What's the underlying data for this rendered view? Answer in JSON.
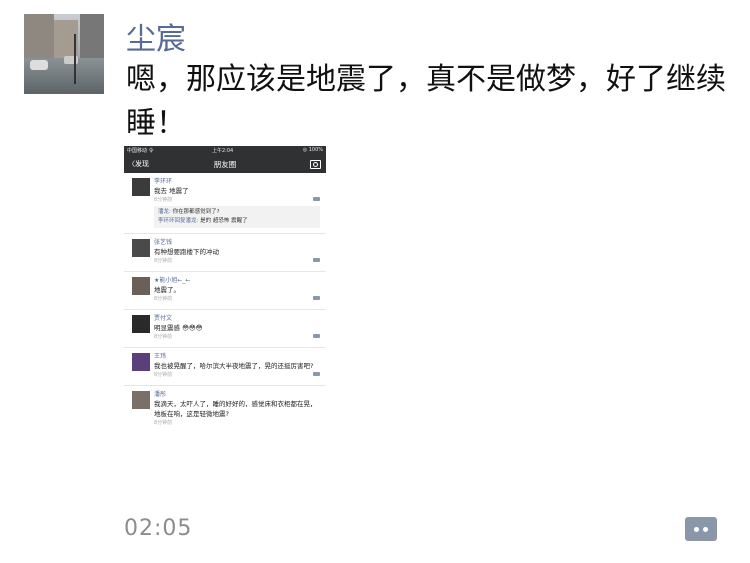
{
  "sender": {
    "name": "尘宸"
  },
  "message": {
    "text": "嗯，那应该是地震了，真不是做梦，好了继续睡！"
  },
  "time": "02:05",
  "phone": {
    "status_bar": {
      "carrier": "中国移动 令",
      "clock": "上午2:04",
      "battery": "◎ 100%"
    },
    "nav": {
      "back_label": "〈发现",
      "title": "朋友圈"
    },
    "posts": [
      {
        "name": "李环环",
        "text": "我去 地震了",
        "meta": "8分钟前",
        "replies": [
          {
            "who": "潘龙:",
            "text": "你在那都感觉到了?"
          },
          {
            "who": "李环环回复潘龙:",
            "text": "是的 超恐怖 震醒了"
          }
        ]
      },
      {
        "name": "张艺钱",
        "text": "有种想要跑楼下的冲动",
        "meta": "8分钟前",
        "replies": []
      },
      {
        "name": "★能小旭←_←",
        "text": "地震了。",
        "meta": "8分钟前",
        "replies": []
      },
      {
        "name": "贾付文",
        "text": "明显震感 😳😳😳",
        "meta": "8分钟前",
        "replies": []
      },
      {
        "name": "王玮",
        "text": "我也被晃醒了，哈尔滨大半夜地震了，晃的还挺厉害吧?",
        "meta": "8分钟前",
        "replies": []
      },
      {
        "name": "潘彤",
        "text": "我滴天，太吓人了，睡的好好的，感觉床和衣柜都在晃，地板在响，这是轻微地震?",
        "meta": "8分钟前",
        "replies": []
      }
    ]
  },
  "colors": {
    "link": "#576b95",
    "nav_bg": "#2f3133",
    "comment_btn": "#8a97a8"
  }
}
